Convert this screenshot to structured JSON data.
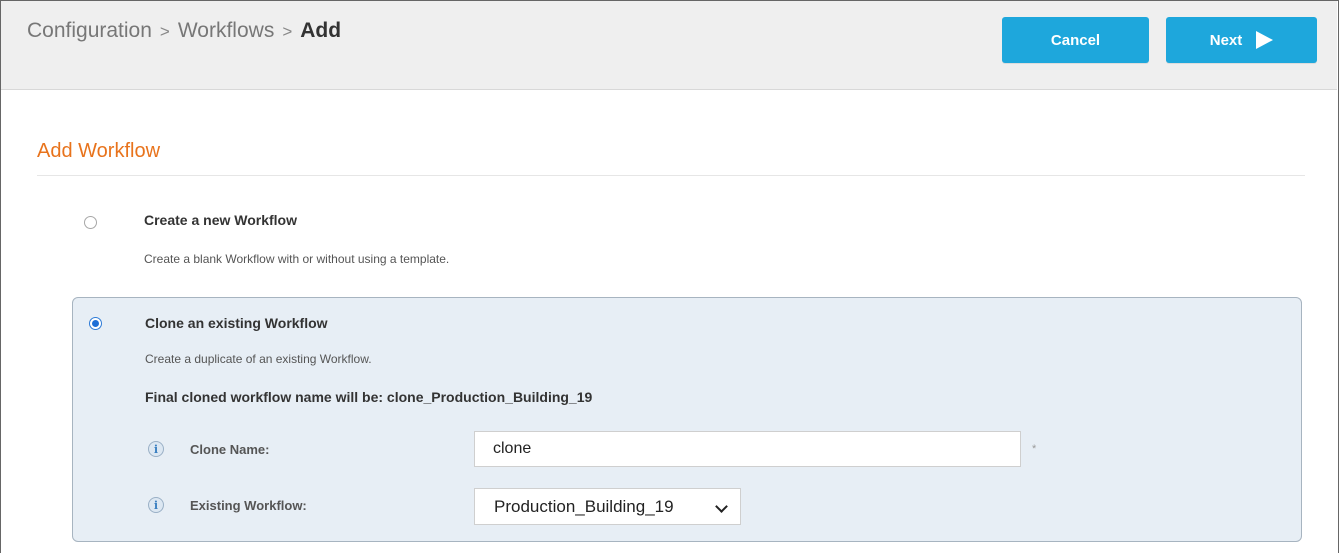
{
  "breadcrumb": {
    "items": [
      "Configuration",
      "Workflows"
    ],
    "separator": ">",
    "current": "Add"
  },
  "header": {
    "cancel_label": "Cancel",
    "next_label": "Next"
  },
  "page": {
    "section_title": "Add Workflow"
  },
  "options": {
    "create_new": {
      "title": "Create a new Workflow",
      "description": "Create a blank Workflow with or without using a template.",
      "selected": false
    },
    "clone": {
      "title": "Clone an existing Workflow",
      "description": "Create a duplicate of an existing Workflow.",
      "final_name_text": "Final cloned workflow name will be: clone_Production_Building_19",
      "selected": true
    }
  },
  "form": {
    "clone_name_label": "Clone Name:",
    "clone_name_value": "clone",
    "required_marker": "*",
    "existing_workflow_label": "Existing Workflow:",
    "existing_workflow_selected": "Production_Building_19"
  },
  "icons": {
    "info": "info-icon",
    "next": "play-arrow-icon",
    "dropdown": "chevron-down-icon"
  },
  "colors": {
    "accent_button": "#1ea7dc",
    "section_title": "#e8731c",
    "selected_panel": "#e7eef5",
    "radio_selected": "#1f6fd6"
  }
}
